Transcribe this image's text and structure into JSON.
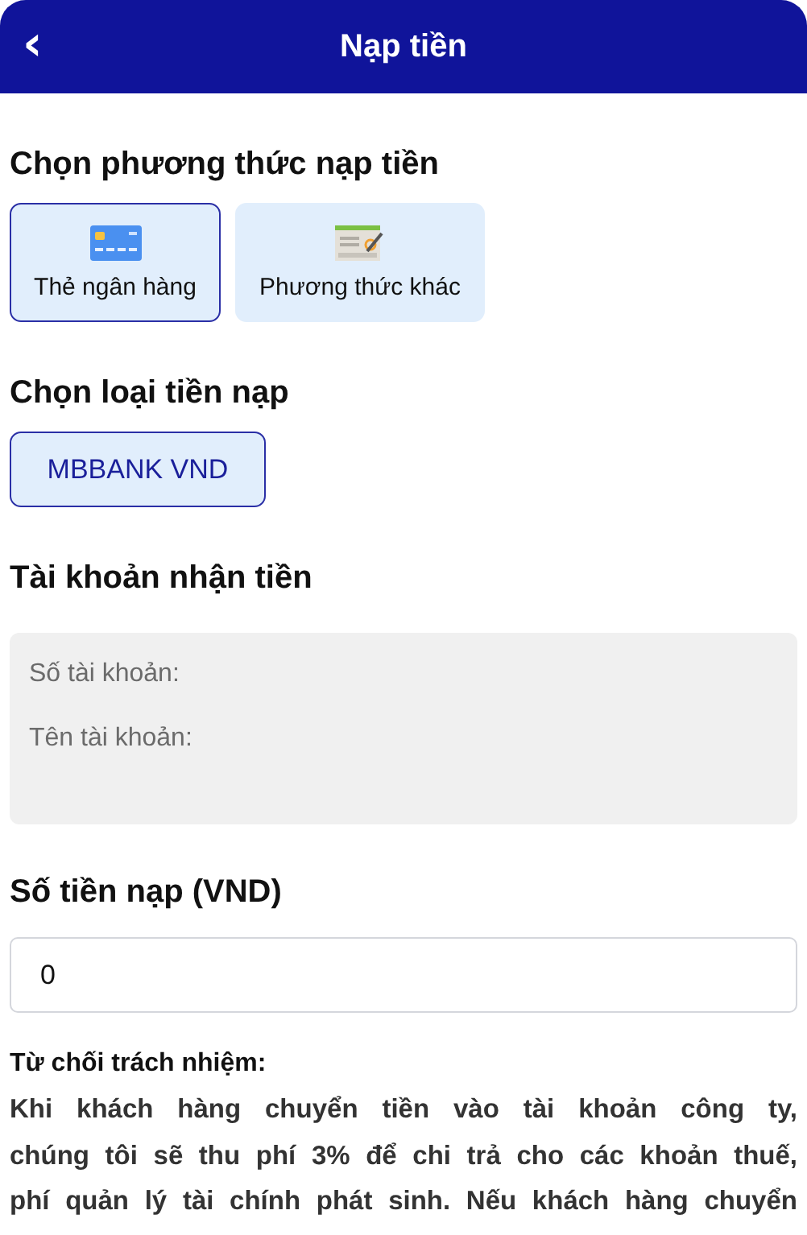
{
  "header": {
    "back_icon": "‹",
    "title": "Nạp tiền"
  },
  "method_section": {
    "heading": "Chọn phương thức nạp tiền",
    "methods": [
      {
        "label": "Thẻ ngân hàng",
        "kind": "card",
        "selected": true
      },
      {
        "label": "Phương thức khác",
        "kind": "form",
        "selected": false
      }
    ]
  },
  "currency_section": {
    "heading": "Chọn loại tiền nạp",
    "options": [
      {
        "label": "MBBANK VND",
        "selected": true
      }
    ]
  },
  "account_section": {
    "heading": "Tài khoản nhận tiền",
    "fields": [
      "Số tài khoản:",
      "Tên tài khoản:"
    ]
  },
  "amount_section": {
    "heading": "Số tiền nạp (VND)",
    "value": "0"
  },
  "disclaimer": {
    "title": "Từ chối trách nhiệm:",
    "lines": [
      "Khi khách hàng chuyển tiền vào tài khoản công ty,",
      "chúng tôi sẽ thu phí 3% để chi trả cho các khoản thuế,",
      "phí quản lý tài chính phát sinh. Nếu khách hàng chuyển"
    ]
  }
}
